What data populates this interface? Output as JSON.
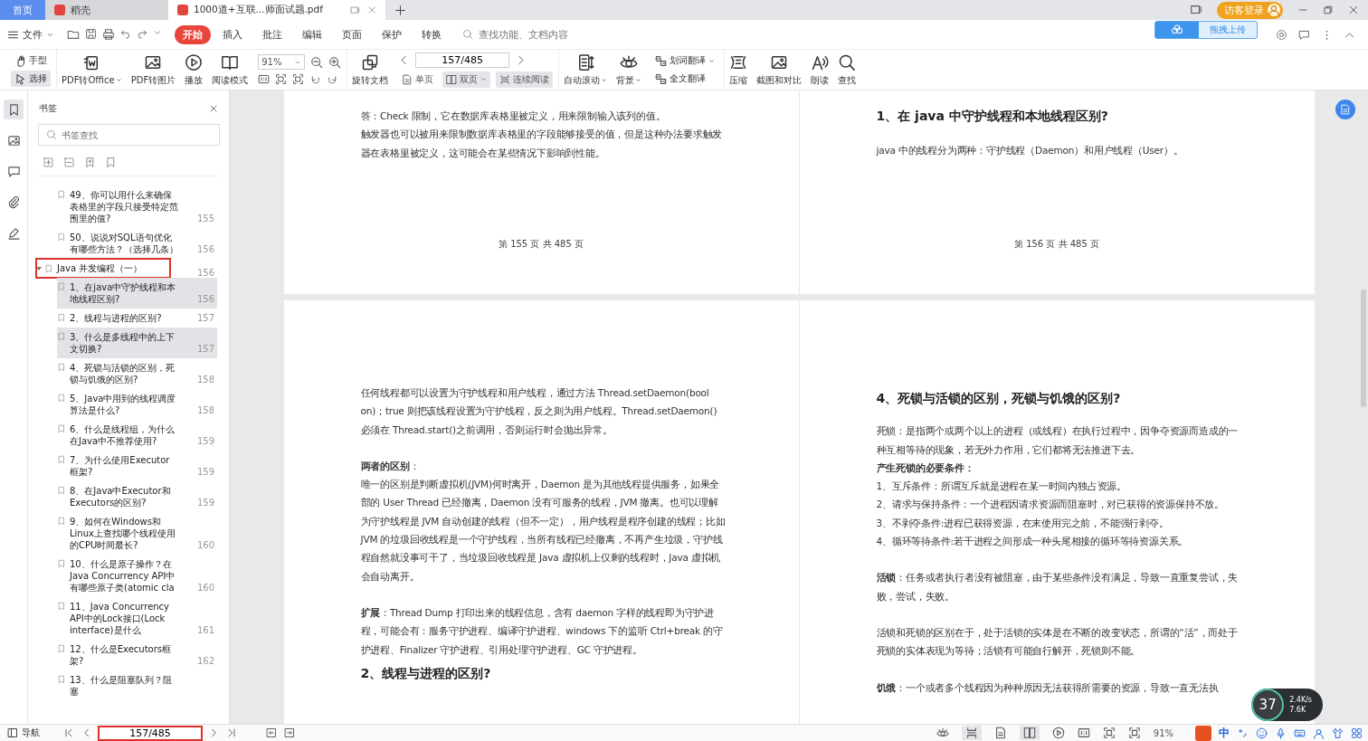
{
  "tabs": [
    {
      "label": "首页",
      "kind": "home",
      "selected": true
    },
    {
      "label": "稻壳",
      "kind": "docer",
      "selected": false
    },
    {
      "label": "1000道+互联...师面试题.pdf",
      "kind": "pdf",
      "selected": false
    }
  ],
  "account": {
    "label": "访客登录"
  },
  "upload_tip": {
    "label": "拖拽上传"
  },
  "file_menu": {
    "label": "文件"
  },
  "menu_tabs": [
    {
      "label": "开始",
      "selected": true
    },
    {
      "label": "插入",
      "selected": false
    },
    {
      "label": "批注",
      "selected": false
    },
    {
      "label": "编辑",
      "selected": false
    },
    {
      "label": "页面",
      "selected": false
    },
    {
      "label": "保护",
      "selected": false
    },
    {
      "label": "转换",
      "selected": false
    }
  ],
  "menu_search": {
    "placeholder": "查找功能、文档内容"
  },
  "ribbon": [
    {
      "kind": "stack",
      "items": [
        {
          "label": "手型",
          "selected": false,
          "caret": false
        },
        {
          "label": "选择",
          "selected": true,
          "caret": false
        }
      ]
    },
    {
      "kind": "large",
      "label": "PDF转Office",
      "caret": true
    },
    {
      "kind": "large",
      "label": "PDF转图片",
      "caret": false
    },
    {
      "kind": "large",
      "label": "播放",
      "caret": false
    },
    {
      "kind": "large",
      "label": "阅读模式",
      "caret": false
    },
    {
      "kind": "zoom",
      "value": "91%"
    },
    {
      "kind": "large",
      "label": "旋转文档",
      "caret": false
    },
    {
      "kind": "pager",
      "value": "157/485",
      "items": [
        {
          "label": "单页",
          "selected": false,
          "caret": false
        },
        {
          "label": "双页",
          "selected": true,
          "caret": true
        },
        {
          "label": "连续阅读",
          "selected": true,
          "caret": false
        }
      ]
    },
    {
      "kind": "large",
      "label": "自动滚动",
      "caret": true
    },
    {
      "kind": "large",
      "label": "背景",
      "caret": true
    },
    {
      "kind": "stack",
      "items": [
        {
          "label": "划词翻译",
          "selected": false,
          "caret": true
        },
        {
          "label": "全文翻译",
          "selected": false,
          "caret": false
        }
      ]
    },
    {
      "kind": "large",
      "label": "压缩",
      "caret": false
    },
    {
      "kind": "large",
      "label": "截图和对比",
      "caret": false
    },
    {
      "kind": "large",
      "label": "朗读",
      "caret": false
    },
    {
      "kind": "large",
      "label": "查找",
      "caret": false
    }
  ],
  "rail": [
    {
      "selected": true
    },
    {
      "selected": false
    },
    {
      "selected": false
    },
    {
      "selected": false
    },
    {
      "selected": false
    }
  ],
  "sidebar": {
    "title": "书签",
    "search_placeholder": "书签查找",
    "bookmarks": [
      {
        "title": "49、你可以用什么来确保表格里的字段只接受特定范围里的值?",
        "page": "155",
        "selected": false
      },
      {
        "title": "50、说说对SQL语句优化有哪些方法？（选择几条）",
        "page": "156",
        "selected": false
      },
      {
        "title": "Java 并发编程（一）",
        "page": "156",
        "selected": false,
        "expanded": true,
        "highlighted": true,
        "children": [
          {
            "title": "1、在java中守护线程和本地线程区别?",
            "page": "156",
            "selected": true
          },
          {
            "title": "2、线程与进程的区别?",
            "page": "157",
            "selected": false
          },
          {
            "title": "3、什么是多线程中的上下文切换?",
            "page": "157",
            "selected": true
          },
          {
            "title": "4、死锁与活锁的区别，死锁与饥饿的区别?",
            "page": "158",
            "selected": false
          },
          {
            "title": "5、Java中用到的线程调度算法是什么?",
            "page": "158",
            "selected": false
          },
          {
            "title": "6、什么是线程组，为什么在Java中不推荐使用?",
            "page": "159",
            "selected": false
          },
          {
            "title": "7、为什么使用Executor框架?",
            "page": "159",
            "selected": false
          },
          {
            "title": "8、在Java中Executor和Executors的区别?",
            "page": "159",
            "selected": false
          },
          {
            "title": "9、如何在Windows和Linux上查找哪个线程使用的CPU时间最长?",
            "page": "160",
            "selected": false
          },
          {
            "title": "10、什么是原子操作？在Java Concurrency API中有哪些原子类(atomic cla",
            "page": "160",
            "selected": false
          },
          {
            "title": "11、Java Concurrency API中的Lock接口(Lock interface)是什么",
            "page": "161",
            "selected": false
          },
          {
            "title": "12、什么是Executors框架?",
            "page": "162",
            "selected": false
          },
          {
            "title": "13、什么是阻塞队列？阻塞",
            "selected": false
          }
        ]
      }
    ]
  },
  "pages": [
    {
      "blocks": [
        {
          "kind": "p",
          "text": "答：Check 限制，它在数据库表格里被定义，用来限制输入该列的值。"
        },
        {
          "kind": "p",
          "text": "触发器也可以被用来限制数据库表格里的字段能够接受的值，但是这种办法要求触发器在表格里被定义，这可能会在某些情况下影响到性能。"
        },
        {
          "kind": "footer",
          "text": "第 155 页 共 485 页"
        }
      ]
    },
    {
      "blocks": [
        {
          "kind": "h",
          "text": "1、在 java 中守护线程和本地线程区别?"
        },
        {
          "kind": "p",
          "text": "java 中的线程分为两种：守护线程（Daemon）和用户线程（User）。"
        },
        {
          "kind": "footer",
          "text": "第 156 页 共 485 页"
        }
      ]
    },
    {
      "blocks": [
        {
          "kind": "p",
          "text": "任何线程都可以设置为守护线程和用户线程，通过方法 Thread.setDaemon(bool on)；true 则把该线程设置为守护线程，反之则为用户线程。Thread.setDaemon() 必须在 Thread.start()之前调用，否则运行时会抛出异常。"
        },
        {
          "kind": "gap"
        },
        {
          "kind": "p",
          "text": "**两者的区别**："
        },
        {
          "kind": "p",
          "text": "唯一的区别是判断虚拟机(JVM)何时离开，Daemon 是为其他线程提供服务，如果全部的 User Thread 已经撤离，Daemon 没有可服务的线程，JVM 撤离。也可以理解为守护线程是 JVM 自动创建的线程（但不一定），用户线程是程序创建的线程；比如 JVM 的垃圾回收线程是一个守护线程，当所有线程已经撤离，不再产生垃圾，守护线程自然就没事可干了，当垃圾回收线程是 Java 虚拟机上仅剩的线程时，Java 虚拟机会自动离开。"
        },
        {
          "kind": "gap"
        },
        {
          "kind": "p",
          "text": "**扩展**：Thread Dump 打印出来的线程信息，含有 daemon 字样的线程即为守护进程，可能会有：服务守护进程、编译守护进程、windows 下的监听 Ctrl+break 的守护进程、Finalizer 守护进程、引用处理守护进程、GC 守护进程。"
        },
        {
          "kind": "h",
          "text": "2、线程与进程的区别?"
        }
      ]
    },
    {
      "blocks": [
        {
          "kind": "h",
          "text": "4、死锁与活锁的区别，死锁与饥饿的区别?"
        },
        {
          "kind": "p",
          "text": "死锁：是指两个或两个以上的进程（或线程）在执行过程中，因争夺资源而造成的一种互相等待的现象，若无外力作用，它们都将无法推进下去。"
        },
        {
          "kind": "b",
          "text": "产生死锁的必要条件："
        },
        {
          "kind": "p",
          "text": "1、互斥条件：所谓互斥就是进程在某一时间内独占资源。"
        },
        {
          "kind": "p",
          "text": "2、请求与保持条件：一个进程因请求资源而阻塞时，对已获得的资源保持不放。"
        },
        {
          "kind": "p",
          "text": "3、不剥夺条件:进程已获得资源，在末使用完之前，不能强行剥夺。"
        },
        {
          "kind": "p",
          "text": "4、循环等待条件:若干进程之间形成一种头尾相接的循环等待资源关系。"
        },
        {
          "kind": "gap"
        },
        {
          "kind": "p",
          "text": "**活锁**：任务或者执行者没有被阻塞，由于某些条件没有满足，导致一直重复尝试，失败，尝试，失败。"
        },
        {
          "kind": "gap"
        },
        {
          "kind": "p",
          "text": "活锁和死锁的区别在于，处于活锁的实体是在不断的改变状态，所谓的“活”，而处于死锁的实体表现为等待；活锁有可能自行解开，死锁则不能。"
        },
        {
          "kind": "gap"
        },
        {
          "kind": "p",
          "text": "**饥饿**：一个或者多个线程因为种种原因无法获得所需要的资源，导致一直无法执"
        }
      ]
    }
  ],
  "status": {
    "nav_label": "导航",
    "page": "157/485",
    "page_highlighted": true,
    "zoom": "91%",
    "ime_label": "中"
  },
  "meter": {
    "value": "37",
    "up": "2.4K/s",
    "down": "7.6K"
  }
}
